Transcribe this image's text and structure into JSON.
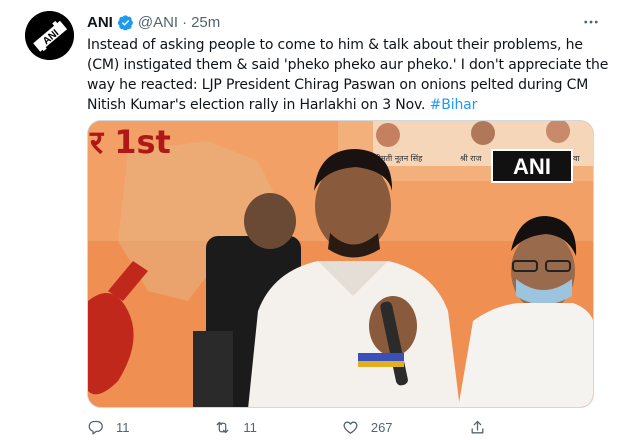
{
  "tweet": {
    "author_name": "ANI",
    "handle": "@ANI",
    "separator": "·",
    "time": "25m",
    "text_lines": [
      "Instead of asking people to come to him & talk about their problems, he",
      "(CM) instigated them & said 'pheko pheko aur pheko.' I don't appreciate the",
      "way he reacted: LJP President Chirag Paswan on onions pelted during CM"
    ],
    "text_last": "Nitish Kumar's election rally in Harlakhi on 3 Nov. ",
    "hashtag": "#Bihar"
  },
  "media": {
    "watermark": "ANI",
    "banner_text": "र 1st",
    "banner_names": [
      "श्रीमती नूतन सिंह",
      "श्री राज",
      "जू तिवा"
    ]
  },
  "actions": {
    "reply_count": "11",
    "retweet_count": "11",
    "like_count": "267"
  },
  "colors": {
    "accent": "#1d9bf0",
    "muted": "#536471",
    "verified": "#1d9bf0"
  },
  "icons": {
    "avatar": "ani-logo-icon",
    "verified": "verified-badge-icon",
    "more": "more-dots-icon",
    "reply": "reply-icon",
    "retweet": "retweet-icon",
    "like": "heart-icon",
    "share": "share-icon"
  }
}
